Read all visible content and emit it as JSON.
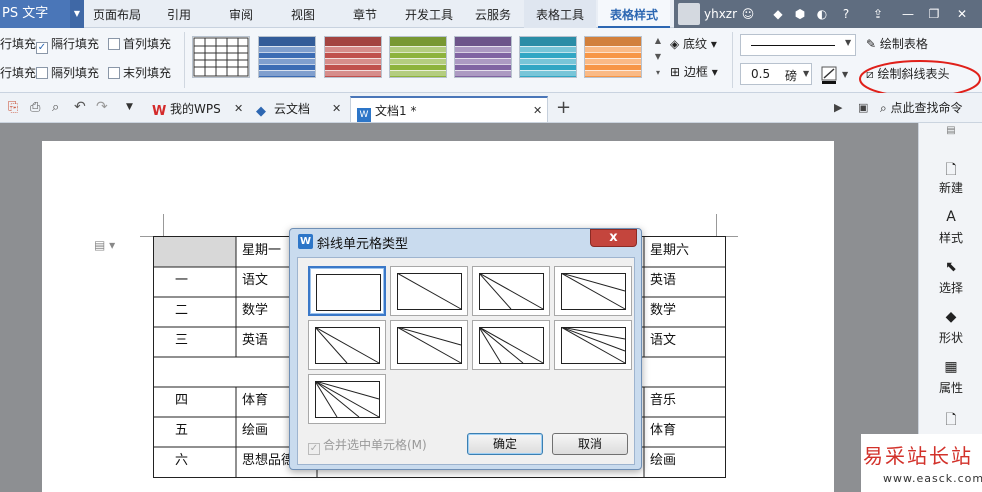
{
  "app": {
    "name": "PS 文字"
  },
  "menu": {
    "items": [
      "页面布局",
      "引用",
      "审阅",
      "视图",
      "章节",
      "开发工具",
      "云服务"
    ],
    "tool_tabs": [
      "表格工具",
      "表格样式"
    ],
    "active": "表格样式"
  },
  "user": {
    "name": "yhxzr"
  },
  "ribbon": {
    "checks": [
      {
        "label": "行填充",
        "checked": false
      },
      {
        "label": "隔行填充",
        "checked": true
      },
      {
        "label": "首列填充",
        "checked": false
      },
      {
        "label": "行填充",
        "checked": false
      },
      {
        "label": "隔列填充",
        "checked": false
      },
      {
        "label": "末列填充",
        "checked": false
      }
    ],
    "shading_label": "底纹",
    "border_label": "边框",
    "line_width": "0.5",
    "line_unit": "磅",
    "draw_table_label": "绘制表格",
    "draw_diagonal_label": "绘制斜线表头",
    "style_colors": [
      "#333333",
      "#3c6cb4",
      "#c0504d",
      "#8db33c",
      "#8064a2",
      "#31a6c4",
      "#f79646"
    ]
  },
  "tabs": [
    {
      "label": "我的WPS"
    },
    {
      "label": "云文档"
    },
    {
      "label": "文档1 *"
    }
  ],
  "search": {
    "label": "点此查找命令"
  },
  "right_panel": {
    "items": [
      "新建",
      "样式",
      "选择",
      "形状",
      "属性"
    ]
  },
  "table": {
    "header": [
      "",
      "星期一",
      "星期六"
    ],
    "rows": [
      [
        "一",
        "语文",
        "英语"
      ],
      [
        "二",
        "数学",
        "数学"
      ],
      [
        "三",
        "英语",
        "语文"
      ],
      [
        "",
        "",
        ""
      ],
      [
        "四",
        "体育",
        "音乐"
      ],
      [
        "五",
        "绘画",
        "体育"
      ],
      [
        "六",
        "思想品德",
        "绘画"
      ]
    ]
  },
  "dialog": {
    "title": "斜线单元格类型",
    "close_label": "x",
    "merge_label": "合并选中单元格(M)",
    "ok_label": "确定",
    "cancel_label": "取消",
    "options": [
      "none",
      "diag-1",
      "diag-2-bottom",
      "diag-2-top",
      "diag-2-left",
      "diag-2-right",
      "diag-3-a",
      "diag-3-b",
      "diag-4"
    ],
    "selected": "none"
  },
  "watermark": {
    "main": "易采站长站",
    "sub": "www.easck.com"
  }
}
